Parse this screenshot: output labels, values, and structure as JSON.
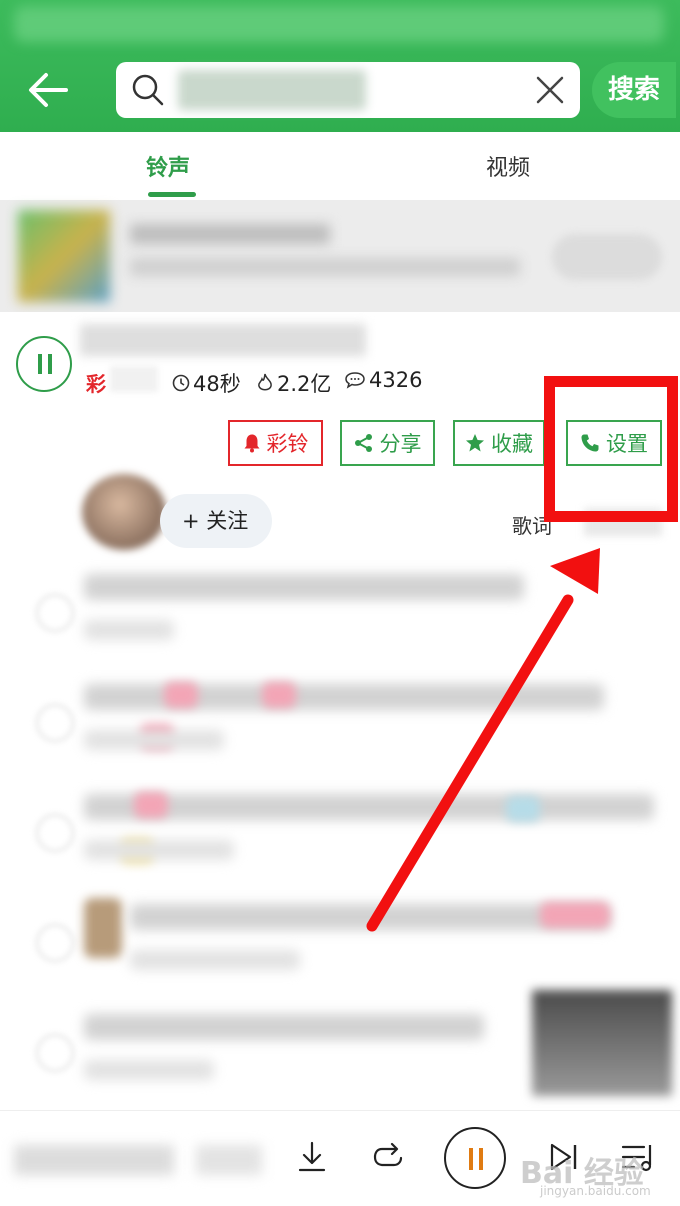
{
  "header": {
    "search_button_label": "搜索"
  },
  "tabs": [
    {
      "label": "铃声",
      "active": true
    },
    {
      "label": "视频",
      "active": false
    }
  ],
  "song": {
    "tag": "彩",
    "duration": "48秒",
    "heat": "2.2亿",
    "comments": "4326",
    "actions": {
      "cailing": "彩铃",
      "share": "分享",
      "favorite": "收藏",
      "set": "设置"
    },
    "follow_label": "+ 关注",
    "lyrics_label": "歌词"
  },
  "watermark": {
    "brand": "Bai 经验",
    "url": "jingyan.baidu.com"
  },
  "colors": {
    "brand_green": "#2f9d4a",
    "header_green": "#35b454",
    "cailing_red": "#e3262b",
    "annotation_red": "#f21010",
    "pause_orange": "#e07b12"
  },
  "icons": [
    "back-arrow-icon",
    "search-icon",
    "clear-icon",
    "pause-icon",
    "clock-icon",
    "flame-icon",
    "comment-icon",
    "bell-icon",
    "share-icon",
    "star-icon",
    "phone-icon",
    "download-icon",
    "repeat-icon",
    "next-icon",
    "playlist-icon"
  ]
}
